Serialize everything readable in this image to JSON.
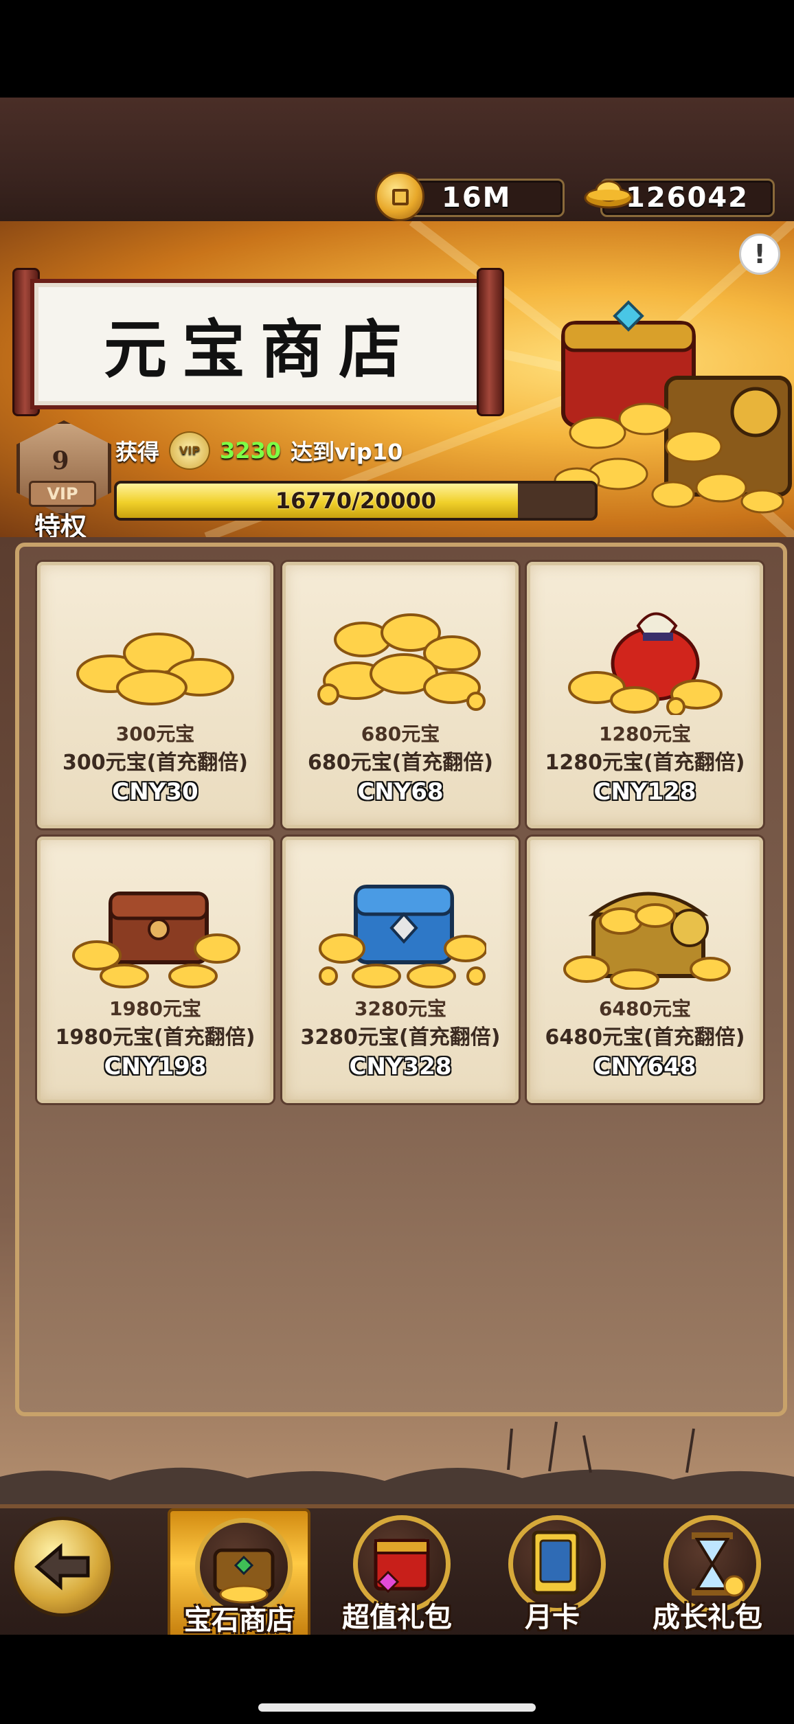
{
  "currency": {
    "gold": "16M",
    "ingot": "126042"
  },
  "banner": {
    "title": "元宝商店",
    "vip_level": "9",
    "vip_tag": "VIP",
    "privilege_label": "特权",
    "progress_prefix": "获得",
    "progress_amount": "3230",
    "progress_target": "达到vip10",
    "progress_text": "16770/20000",
    "progress_fraction": 0.8385
  },
  "products": [
    {
      "name": "300元宝",
      "desc": "300元宝(首充翻倍)",
      "price": "CNY30",
      "icon": "small-ingot-pile-icon"
    },
    {
      "name": "680元宝",
      "desc": "680元宝(首充翻倍)",
      "price": "CNY68",
      "icon": "ingot-pile-icon"
    },
    {
      "name": "1280元宝",
      "desc": "1280元宝(首充翻倍)",
      "price": "CNY128",
      "icon": "money-bag-icon"
    },
    {
      "name": "1980元宝",
      "desc": "1980元宝(首充翻倍)",
      "price": "CNY198",
      "icon": "wooden-chest-icon"
    },
    {
      "name": "3280元宝",
      "desc": "3280元宝(首充翻倍)",
      "price": "CNY328",
      "icon": "blue-chest-icon"
    },
    {
      "name": "6480元宝",
      "desc": "6480元宝(首充翻倍)",
      "price": "CNY648",
      "icon": "golden-chest-icon"
    }
  ],
  "nav": [
    {
      "label": "宝石商店",
      "icon": "treasure-chest-icon",
      "active": true
    },
    {
      "label": "超值礼包",
      "icon": "gift-box-icon",
      "active": false
    },
    {
      "label": "月卡",
      "icon": "month-card-icon",
      "active": false
    },
    {
      "label": "成长礼包",
      "icon": "hourglass-icon",
      "active": false
    }
  ],
  "colors": {
    "accent_gold": "#f0d02a",
    "progress_green": "#7dff46",
    "panel_border": "#c8a26a"
  }
}
